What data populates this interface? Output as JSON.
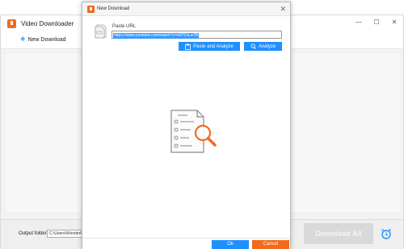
{
  "main_window": {
    "title": "Video Downloader",
    "controls": {
      "minimize": "—",
      "maximize": "☐",
      "close": "✕"
    },
    "toolbar": {
      "new_download_label": "New Download"
    },
    "bottom": {
      "output_label": "Output folder:",
      "output_path": "C:\\Users\\WonderFox",
      "download_all_label": "Download All"
    }
  },
  "dialog": {
    "title": "New Download",
    "close_glyph": "✕",
    "paste_url_label": "Paste URL",
    "url_value": "https://www.youtube.com/watch?v=rEPZvLaTB",
    "paste_analyze_label": "Paste and Analyze",
    "analyze_label": "Analyze",
    "ok_label": "Ok",
    "cancel_label": "Cancel"
  },
  "colors": {
    "accent_blue": "#1e90ff",
    "accent_orange": "#f26a1b",
    "selection_blue": "#3399ff"
  },
  "icons": [
    "app-logo-icon",
    "plus-icon",
    "url-doc-icon",
    "clipboard-icon",
    "search-icon",
    "magnifier-icon",
    "alarm-clock-icon",
    "close-icon"
  ]
}
